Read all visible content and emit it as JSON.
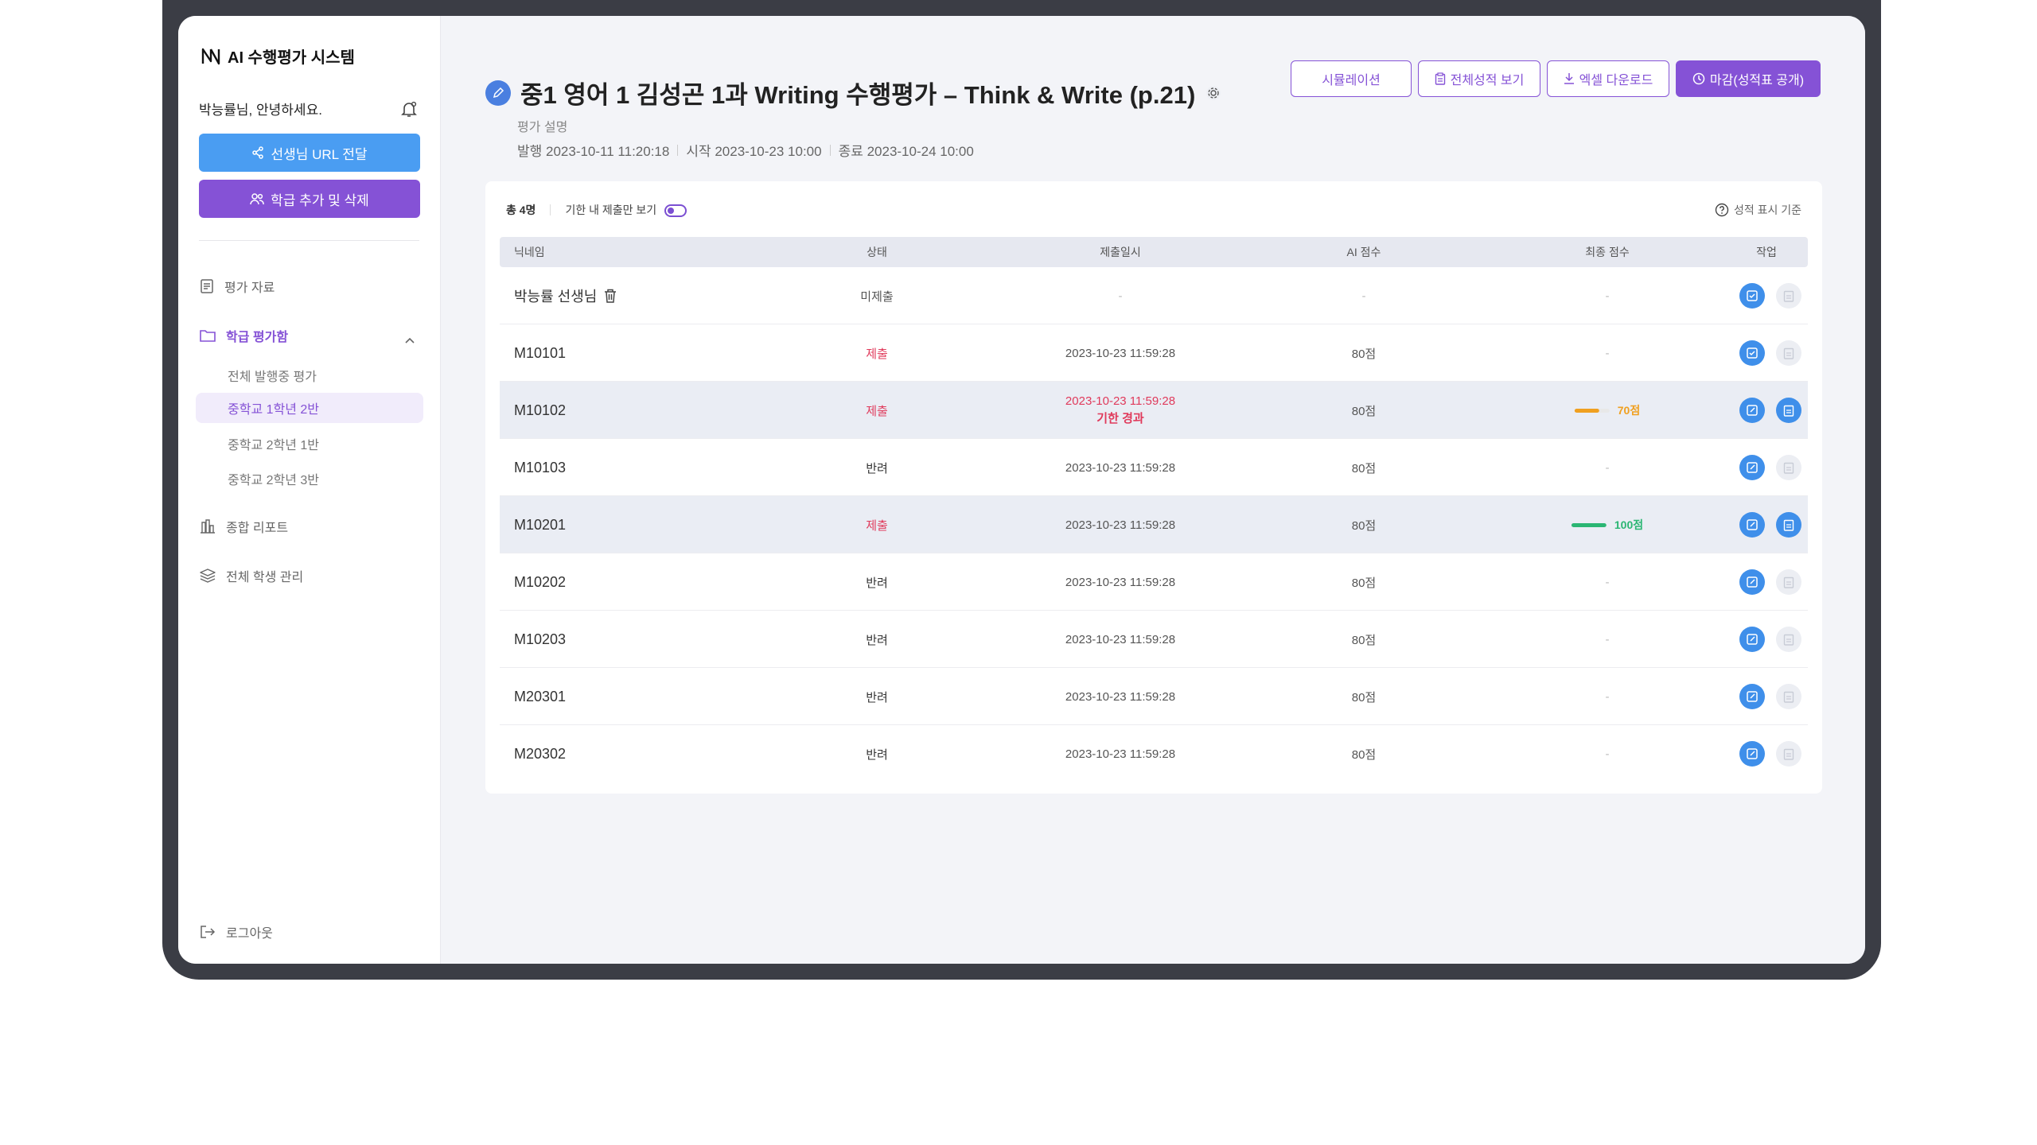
{
  "app": {
    "brand": "AI 수행평가 시스템"
  },
  "sidebar": {
    "greeting": "박능률님, 안녕하세요.",
    "url_button": "선생님 URL 전달",
    "class_button": "학급 추가 및 삭제",
    "nav": {
      "materials": "평가 자료",
      "class_box": "학급 평가함",
      "report": "종합 리포트",
      "students": "전체 학생 관리"
    },
    "sub_items": [
      "전체 발행중 평가",
      "중학교 1학년 2반",
      "중학교 2학년 1반",
      "중학교 2학년 3반"
    ],
    "selected_sub": 1,
    "logout": "로그아웃"
  },
  "header": {
    "title": "중1 영어 1 김성곤 1과 Writing 수행평가 – Think & Write (p.21)",
    "desc": "평가 설명",
    "published": "발행 2023-10-11 11:20:18",
    "start": "시작 2023-10-23 10:00",
    "end": "종료 2023-10-24 10:00",
    "actions": {
      "simulation": "시뮬레이션",
      "all_scores": "전체성적 보기",
      "excel": "엑셀 다운로드",
      "close": "마감(성적표 공개)"
    }
  },
  "table": {
    "total": "총 4명",
    "filter_label": "기한 내 제출만 보기",
    "criteria": "성적 표시 기준",
    "columns": {
      "nick": "닉네임",
      "status": "상태",
      "date": "제출일시",
      "ai": "AI 점수",
      "final": "최종 점수",
      "action": "작업"
    },
    "rows": [
      {
        "nick": "박능률 선생님",
        "status": "미제출",
        "date": "-",
        "ai": "-",
        "final": "-"
      },
      {
        "nick": "M10101",
        "status": "제출",
        "date": "2023-10-23 11:59:28",
        "ai": "80점",
        "final": "-"
      },
      {
        "nick": "M10102",
        "status": "제출",
        "date": "2023-10-23 11:59:28",
        "late": "기한 경과",
        "ai": "80점",
        "final": "70점"
      },
      {
        "nick": "M10103",
        "status": "반려",
        "date": "2023-10-23 11:59:28",
        "ai": "80점",
        "final": "-"
      },
      {
        "nick": "M10201",
        "status": "제출",
        "date": "2023-10-23 11:59:28",
        "ai": "80점",
        "final": "100점"
      },
      {
        "nick": "M10202",
        "status": "반려",
        "date": "2023-10-23 11:59:28",
        "ai": "80점",
        "final": "-"
      },
      {
        "nick": "M10203",
        "status": "반려",
        "date": "2023-10-23 11:59:28",
        "ai": "80점",
        "final": "-"
      },
      {
        "nick": "M20301",
        "status": "반려",
        "date": "2023-10-23 11:59:28",
        "ai": "80점",
        "final": "-"
      },
      {
        "nick": "M20302",
        "status": "반려",
        "date": "2023-10-23 11:59:28",
        "ai": "80점",
        "final": "-"
      }
    ],
    "score_levels": {
      "row2": 0.7,
      "row4": 1.0
    }
  },
  "colors": {
    "purple": "#8552d6",
    "blue": "#4a9df2",
    "red": "#e03a5b",
    "orange": "#f0a020",
    "green": "#2bb673"
  }
}
